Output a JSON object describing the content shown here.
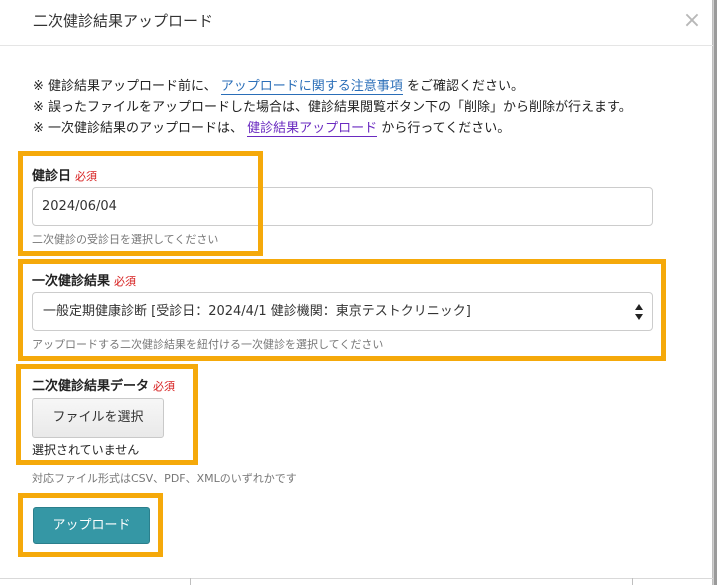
{
  "dialog": {
    "title": "二次健診結果アップロード",
    "close_glyph": "×"
  },
  "notes": {
    "line1": {
      "prefix": "※ 健診結果アップロード前に、",
      "link": "アップロードに関する注意事項",
      "suffix": "をご確認ください。"
    },
    "line2": {
      "text": "※ 誤ったファイルをアップロードした場合は、健診結果閲覧ボタン下の「削除」から削除が行えます。"
    },
    "line3": {
      "prefix": "※ 一次健診結果のアップロードは、",
      "link": "健診結果アップロード",
      "suffix": "から行ってください。"
    }
  },
  "checkup_date": {
    "label": "健診日",
    "required": "必須",
    "value": "2024/06/04",
    "help": "二次健診の受診日を選択してください"
  },
  "primary_result": {
    "label": "一次健診結果",
    "required": "必須",
    "selected": "一般定期健康診断 [受診日：2024/4/1 健診機関：東京テストクリニック]",
    "help": "アップロードする二次健診結果を紐付ける一次健診を選択してください"
  },
  "secondary_data": {
    "label": "二次健診結果データ",
    "required": "必須",
    "file_button": "ファイルを選択",
    "file_status": "選択されていません",
    "help": "対応ファイル形式はCSV、PDF、XMLのいずれかです"
  },
  "actions": {
    "upload": "アップロード"
  },
  "colors": {
    "highlight": "#f5a90a",
    "primary_button": "#3597a5",
    "link": "#2a6eb8",
    "visited_link": "#6a2ac0",
    "required": "#d61c1c"
  }
}
